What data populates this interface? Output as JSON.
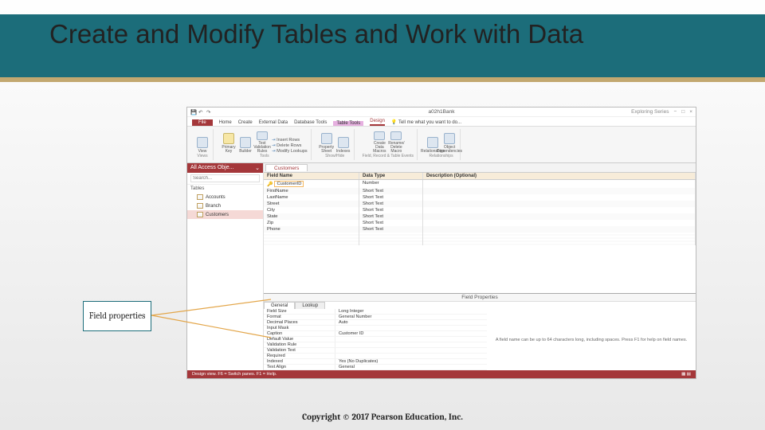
{
  "slide": {
    "title": "Create and Modify Tables and Work with Data",
    "copyright": "Copyright © 2017 Pearson Education, Inc."
  },
  "callout": {
    "label": "Field properties"
  },
  "window": {
    "title": "a02h1Bank",
    "qat": [
      "save",
      "undo",
      "redo"
    ],
    "right": [
      "Exploring Series",
      "−",
      "□",
      "×"
    ]
  },
  "ribbontabs": {
    "file": "File",
    "items": [
      "Home",
      "Create",
      "External Data",
      "Database Tools"
    ],
    "context_group": "Table Tools",
    "context_active": "Design",
    "tell_me": "Tell me what you want to do..."
  },
  "ribbon": {
    "groups": [
      {
        "label": "Views",
        "icons": [
          {
            "lbl": "View"
          }
        ]
      },
      {
        "label": "Tools",
        "icons": [
          {
            "lbl": "Primary Key",
            "key": true
          },
          {
            "lbl": "Builder"
          },
          {
            "lbl": "Test Validation Rules"
          }
        ],
        "rows": [
          "Insert Rows",
          "Delete Rows",
          "Modify Lookups"
        ]
      },
      {
        "label": "Show/Hide",
        "icons": [
          {
            "lbl": "Property Sheet"
          },
          {
            "lbl": "Indexes"
          }
        ]
      },
      {
        "label": "Field, Record & Table Events",
        "icons": [
          {
            "lbl": "Create Data Macros"
          },
          {
            "lbl": "Rename/ Delete Macro"
          }
        ]
      },
      {
        "label": "Relationships",
        "icons": [
          {
            "lbl": "Relationships"
          },
          {
            "lbl": "Object Dependencies"
          }
        ]
      }
    ]
  },
  "nav": {
    "header": "All Access Obje...",
    "search_placeholder": "Search...",
    "group": "Tables",
    "items": [
      "Accounts",
      "Branch",
      "Customers"
    ],
    "selected": "Customers"
  },
  "objecttab": "Customers",
  "grid": {
    "headers": [
      "Field Name",
      "Data Type",
      "Description (Optional)"
    ],
    "rows": [
      {
        "name": "CustomerID",
        "type": "Number",
        "pk": true,
        "sel": true
      },
      {
        "name": "FirstName",
        "type": "Short Text"
      },
      {
        "name": "LastName",
        "type": "Short Text"
      },
      {
        "name": "Street",
        "type": "Short Text"
      },
      {
        "name": "City",
        "type": "Short Text"
      },
      {
        "name": "State",
        "type": "Short Text"
      },
      {
        "name": "Zip",
        "type": "Short Text"
      },
      {
        "name": "Phone",
        "type": "Short Text"
      }
    ]
  },
  "fieldprops": {
    "pane_title": "Field Properties",
    "tabs": [
      "General",
      "Lookup"
    ],
    "items": [
      {
        "k": "Field Size",
        "v": "Long Integer"
      },
      {
        "k": "Format",
        "v": "General Number"
      },
      {
        "k": "Decimal Places",
        "v": "Auto"
      },
      {
        "k": "Input Mask",
        "v": ""
      },
      {
        "k": "Caption",
        "v": "Customer ID"
      },
      {
        "k": "Default Value",
        "v": ""
      },
      {
        "k": "Validation Rule",
        "v": ""
      },
      {
        "k": "Validation Text",
        "v": ""
      },
      {
        "k": "Required",
        "v": ""
      },
      {
        "k": "Indexed",
        "v": "Yes (No Duplicates)"
      },
      {
        "k": "Text Align",
        "v": "General"
      }
    ],
    "help": "A field name can be up to 64 characters long, including spaces. Press F1 for help on field names."
  },
  "statusbar": {
    "left": "Design view.  F6 = Switch panes.  F1 = Help.",
    "right": ""
  }
}
